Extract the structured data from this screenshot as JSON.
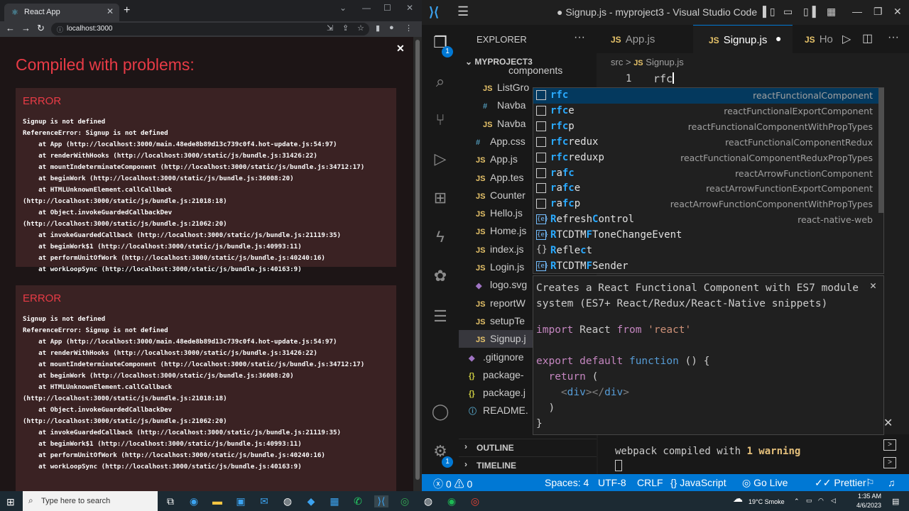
{
  "chrome": {
    "tab_title": "React App",
    "url": "localhost:3000",
    "overlay_title": "Compiled with problems:",
    "errors": [
      {
        "heading": "ERROR",
        "lines": [
          "Signup is not defined",
          "ReferenceError: Signup is not defined",
          "    at App (http://localhost:3000/main.48ede8b89d13c739c0f4.hot-update.js:54:97)",
          "    at renderWithHooks (http://localhost:3000/static/js/bundle.js:31426:22)",
          "    at mountIndeterminateComponent (http://localhost:3000/static/js/bundle.js:34712:17)",
          "    at beginWork (http://localhost:3000/static/js/bundle.js:36008:20)",
          "    at HTMLUnknownElement.callCallback",
          "(http://localhost:3000/static/js/bundle.js:21018:18)",
          "    at Object.invokeGuardedCallbackDev",
          "(http://localhost:3000/static/js/bundle.js:21062:20)",
          "    at invokeGuardedCallback (http://localhost:3000/static/js/bundle.js:21119:35)",
          "    at beginWork$1 (http://localhost:3000/static/js/bundle.js:40993:11)",
          "    at performUnitOfWork (http://localhost:3000/static/js/bundle.js:40240:16)",
          "    at workLoopSync (http://localhost:3000/static/js/bundle.js:40163:9)"
        ]
      },
      {
        "heading": "ERROR",
        "lines": [
          "Signup is not defined",
          "ReferenceError: Signup is not defined",
          "    at App (http://localhost:3000/main.48ede8b89d13c739c0f4.hot-update.js:54:97)",
          "    at renderWithHooks (http://localhost:3000/static/js/bundle.js:31426:22)",
          "    at mountIndeterminateComponent (http://localhost:3000/static/js/bundle.js:34712:17)",
          "    at beginWork (http://localhost:3000/static/js/bundle.js:36008:20)",
          "    at HTMLUnknownElement.callCallback",
          "(http://localhost:3000/static/js/bundle.js:21018:18)",
          "    at Object.invokeGuardedCallbackDev",
          "(http://localhost:3000/static/js/bundle.js:21062:20)",
          "    at invokeGuardedCallback (http://localhost:3000/static/js/bundle.js:21119:35)",
          "    at beginWork$1 (http://localhost:3000/static/js/bundle.js:40993:11)",
          "    at performUnitOfWork (http://localhost:3000/static/js/bundle.js:40240:16)",
          "    at workLoopSync (http://localhost:3000/static/js/bundle.js:40163:9)"
        ]
      }
    ]
  },
  "vscode": {
    "window_title": "● Signup.js - myproject3 - Visual Studio Code",
    "explorer_label": "EXPLORER",
    "project": "MYPROJECT3",
    "tree": [
      {
        "icon": "",
        "label": "components"
      },
      {
        "icon": "JS",
        "label": "ListGro"
      },
      {
        "icon": "#",
        "label": "Navba"
      },
      {
        "icon": "JS",
        "label": "Navba"
      },
      {
        "icon": "#",
        "label": "App.css"
      },
      {
        "icon": "JS",
        "label": "App.js"
      },
      {
        "icon": "JS",
        "label": "App.tes"
      },
      {
        "icon": "JS",
        "label": "Counter"
      },
      {
        "icon": "JS",
        "label": "Hello.js"
      },
      {
        "icon": "JS",
        "label": "Home.js"
      },
      {
        "icon": "JS",
        "label": "index.js"
      },
      {
        "icon": "JS",
        "label": "Login.js"
      },
      {
        "icon": "◆",
        "label": "logo.svg"
      },
      {
        "icon": "JS",
        "label": "reportW"
      },
      {
        "icon": "JS",
        "label": "setupTe"
      },
      {
        "icon": "JS",
        "label": "Signup.j"
      },
      {
        "icon": "◆",
        "label": ".gitignore"
      },
      {
        "icon": "{}",
        "label": "package-"
      },
      {
        "icon": "{}",
        "label": "package.j"
      },
      {
        "icon": "ⓘ",
        "label": "README."
      }
    ],
    "outline_label": "OUTLINE",
    "timeline_label": "TIMELINE",
    "tabs": [
      {
        "icon": "JS",
        "label": "App.js"
      },
      {
        "icon": "JS",
        "label": "Signup.js"
      },
      {
        "icon": "JS",
        "label": "Ho"
      }
    ],
    "breadcrumb": {
      "folder": "src",
      "sep": ">",
      "icon": "JS",
      "file": "Signup.js"
    },
    "line_number": "1",
    "code_text": "rfc",
    "suggestions": [
      {
        "pre": "",
        "m": "rfc",
        "post": "",
        "detail": "reactFunctionalComponent",
        "kind": "snippet"
      },
      {
        "pre": "",
        "m": "rfc",
        "post": "e",
        "detail": "reactFunctionalExportComponent",
        "kind": "snippet"
      },
      {
        "pre": "",
        "m": "rfc",
        "post": "p",
        "detail": "reactFunctionalComponentWithPropTypes",
        "kind": "snippet"
      },
      {
        "pre": "",
        "m": "rfc",
        "post": "redux",
        "detail": "reactFunctionalComponentRedux",
        "kind": "snippet"
      },
      {
        "pre": "",
        "m": "rfc",
        "post": "reduxp",
        "detail": "reactFunctionalComponentReduxPropTypes",
        "kind": "snippet"
      },
      {
        "pre": "",
        "m": "r",
        "post": "a",
        "m2": "fc",
        "detail": "reactArrowFunctionComponent",
        "kind": "snippet"
      },
      {
        "pre": "",
        "m": "r",
        "post": "a",
        "m2": "fc",
        "post2": "e",
        "detail": "reactArrowFunctionExportComponent",
        "kind": "snippet"
      },
      {
        "pre": "",
        "m": "r",
        "post": "a",
        "m2": "fc",
        "post2": "p",
        "detail": "reactArrowFunctionComponentWithPropTypes",
        "kind": "snippet"
      },
      {
        "pre": "",
        "m": "R",
        "post": "efresh",
        "m2": "C",
        "post2": "ontrol",
        "detail": "react-native-web",
        "kind": "module"
      },
      {
        "pre": "",
        "m": "R",
        "post": "TCDTM",
        "m2": "F",
        "post2": "ToneChangeEvent",
        "detail": "",
        "kind": "module"
      },
      {
        "pre": "",
        "m": "R",
        "post": "efle",
        "m2": "c",
        "post2": "t",
        "detail": "",
        "kind": "namespace"
      },
      {
        "pre": "",
        "m": "R",
        "post": "TCDTM",
        "m2": "F",
        "post2": "Sender",
        "detail": "",
        "kind": "module"
      }
    ],
    "doc_description": "Creates a React Functional Component with ES7 module system (ES7+ React/Redux/React-Native snippets)",
    "terminal": {
      "prefix": "webpack compiled with ",
      "warning": "1 warning"
    },
    "status": {
      "errors": "0",
      "warnings": "0",
      "spaces": "Spaces: 4",
      "encoding": "UTF-8",
      "eol": "CRLF",
      "language": "JavaScript",
      "golive": "Go Live",
      "prettier": "Prettier"
    },
    "explorer_badge": "1",
    "settings_badge": "1"
  },
  "taskbar": {
    "search_placeholder": "Type here to search",
    "weather": "19°C  Smoke",
    "time": "1:35 AM",
    "date": "4/6/2023"
  },
  "colors": {
    "accent": "#0078d4",
    "error_red": "#e83b46",
    "match_blue": "#2aaaff"
  }
}
